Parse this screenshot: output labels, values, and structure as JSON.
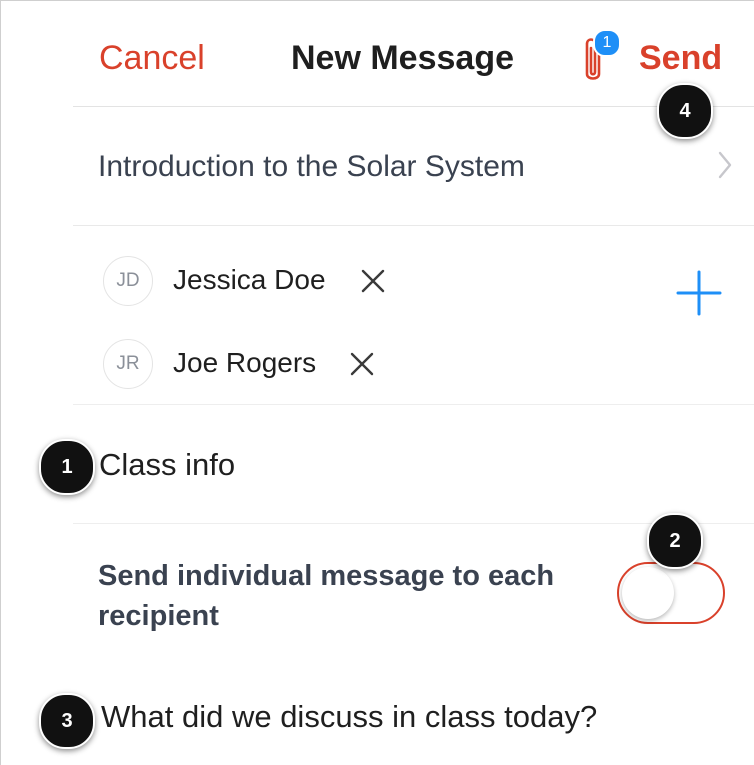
{
  "header": {
    "cancel_label": "Cancel",
    "title": "New Message",
    "attachment_count": "1",
    "send_label": "Send"
  },
  "course": {
    "name": "Introduction to the Solar System"
  },
  "recipients": [
    {
      "initials": "JD",
      "name": "Jessica Doe"
    },
    {
      "initials": "JR",
      "name": "Joe Rogers"
    }
  ],
  "subject": {
    "value": "Class info"
  },
  "individual_message": {
    "label": "Send individual message to each recipient",
    "enabled": false
  },
  "message_body": {
    "value": "What did we discuss in class today?"
  },
  "callouts": [
    "1",
    "2",
    "3",
    "4"
  ],
  "colors": {
    "accent_red": "#d9412b",
    "accent_blue": "#1e8ff7",
    "callout_black": "#111111"
  },
  "icons": {
    "attachment": "paperclip-icon",
    "disclosure": "chevron-right-icon",
    "remove_recipient": "close-icon",
    "add_recipient": "plus-icon"
  }
}
